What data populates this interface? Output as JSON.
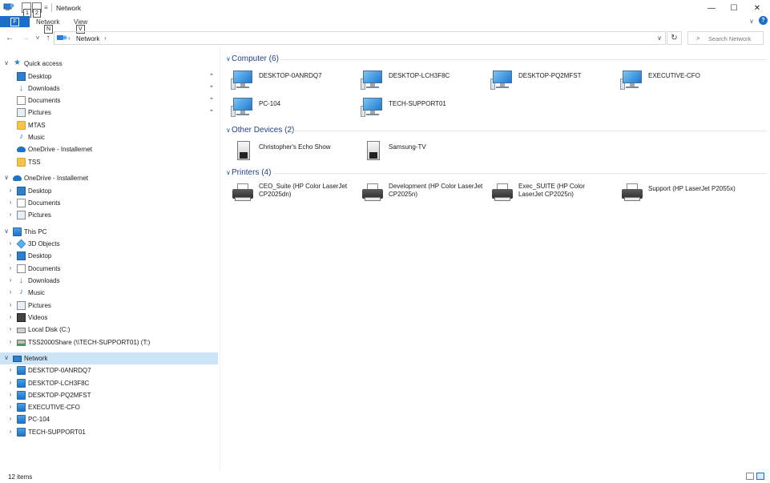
{
  "window": {
    "title": "Network",
    "minimize_glyph": "—",
    "maximize_glyph": "☐",
    "close_glyph": "✕"
  },
  "keytips": {
    "qa1": "1",
    "qa2": "2",
    "network": "N",
    "view": "V",
    "file": "F"
  },
  "ribbon": {
    "tabs": [
      "Network",
      "View"
    ],
    "collapse_glyph": "∨",
    "help_glyph": "?"
  },
  "address": {
    "back": "←",
    "forward": "→",
    "recent": "˅",
    "up": "↑",
    "breadcrumb": "Network",
    "crumb_sep": "›",
    "dropdown": "∨",
    "refresh": "↻",
    "search_placeholder": "Search Network",
    "search_icon": "⌕"
  },
  "sidebar": {
    "quick_access": {
      "label": "Quick access",
      "items": [
        {
          "label": "Desktop",
          "icon": "desktop-folder-icon",
          "pinned": true
        },
        {
          "label": "Downloads",
          "icon": "downloads-icon",
          "pinned": true
        },
        {
          "label": "Documents",
          "icon": "documents-icon",
          "pinned": true
        },
        {
          "label": "Pictures",
          "icon": "pictures-icon",
          "pinned": true
        },
        {
          "label": "MTAS",
          "icon": "folder-icon",
          "pinned": false
        },
        {
          "label": "Music",
          "icon": "music-icon",
          "pinned": false
        },
        {
          "label": "OneDrive - Installernet",
          "icon": "onedrive-icon",
          "pinned": false
        },
        {
          "label": "TSS",
          "icon": "folder-icon",
          "pinned": false
        }
      ]
    },
    "onedrive": {
      "label": "OneDrive - Installernet",
      "items": [
        "Desktop",
        "Documents",
        "Pictures"
      ]
    },
    "this_pc": {
      "label": "This PC",
      "items": [
        "3D Objects",
        "Desktop",
        "Documents",
        "Downloads",
        "Music",
        "Pictures",
        "Videos",
        "Local Disk (C:)",
        "TSS2000Share (\\\\TECH-SUPPORT01) (T:)"
      ]
    },
    "network": {
      "label": "Network",
      "items": [
        "DESKTOP-0ANRDQ7",
        "DESKTOP-LCH3F8C",
        "DESKTOP-PQ2MFST",
        "EXECUTIVE-CFO",
        "PC-104",
        "TECH-SUPPORT01"
      ]
    },
    "pin_glyph": "📌",
    "expanded_glyph": "∨",
    "collapsed_glyph": "›"
  },
  "content": {
    "groups": [
      {
        "title": "Computer (6)",
        "type": "computer",
        "items": [
          "DESKTOP-0ANRDQ7",
          "DESKTOP-LCH3F8C",
          "DESKTOP-PQ2MFST",
          "EXECUTIVE-CFO",
          "PC-104",
          "TECH-SUPPORT01"
        ]
      },
      {
        "title": "Other Devices (2)",
        "type": "device",
        "items": [
          "Christopher's Echo Show",
          "Samsung-TV"
        ]
      },
      {
        "title": "Printers (4)",
        "type": "printer",
        "items": [
          "CEO_Suite (HP Color LaserJet CP2025dn)",
          "Development (HP Color LaserJet CP2025n)",
          "Exec_SUITE (HP Color LaserJet CP2025n)",
          "Support (HP LaserJet P2055x)"
        ]
      }
    ],
    "group_chevron": "∨"
  },
  "status": {
    "item_count": "12 items"
  },
  "colors": {
    "accent": "#1c6ec9",
    "selection": "#cce4f7",
    "group_title": "#1e3f8a"
  }
}
